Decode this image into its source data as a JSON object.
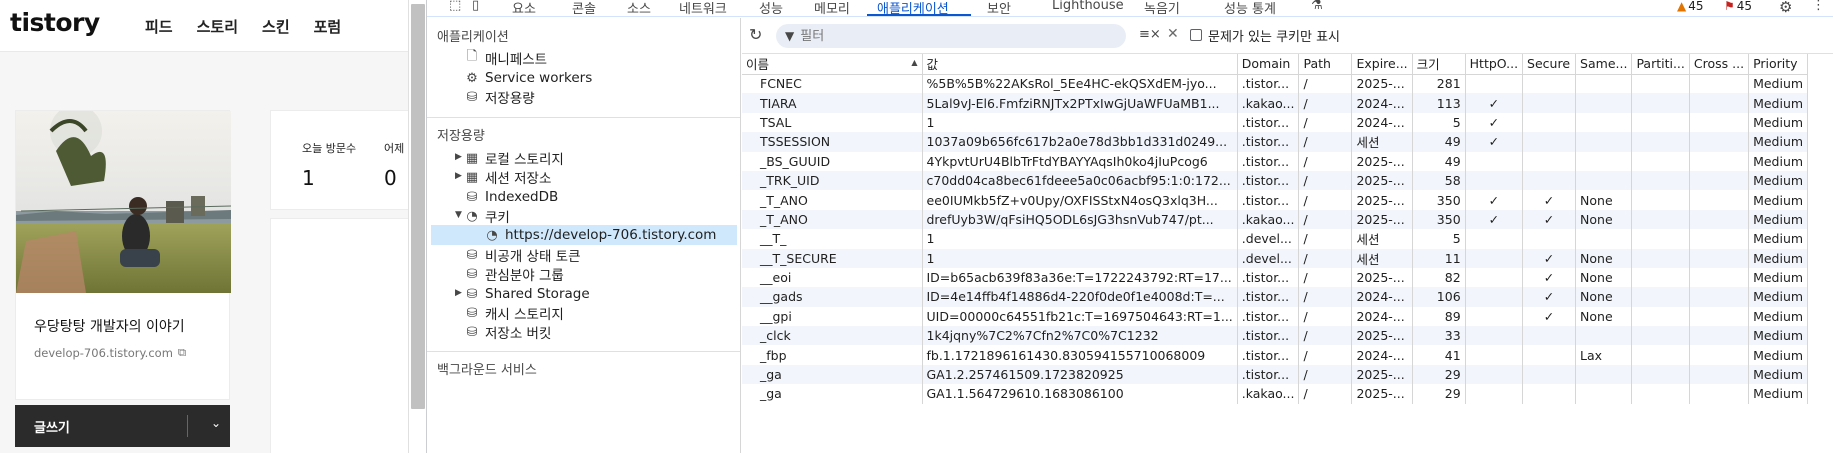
{
  "blog": {
    "logo": "tistory",
    "nav": [
      "피드",
      "스토리",
      "스킨",
      "포럼"
    ],
    "blog_name": "우당탕탕 개발자의 이야기",
    "blog_url": "develop-706.tistory.com",
    "write_button": "글쓰기",
    "stats": {
      "today_label": "오늘 방문수",
      "today_value": "1",
      "yesterday_label": "어제 방문수",
      "yesterday_value": "0"
    }
  },
  "devtools": {
    "tabs": [
      "요소",
      "콘솔",
      "소스",
      "네트워크",
      "성능",
      "메모리",
      "애플리케이션",
      "보안",
      "Lighthouse",
      "녹음기",
      "성능 통계"
    ],
    "active_tab": "애플리케이션",
    "warnings_count": "45",
    "issues_count": "45",
    "sidebar": {
      "application_header": "애플리케이션",
      "application_items": [
        "매니페스트",
        "Service workers",
        "저장용량"
      ],
      "storage_header": "저장용량",
      "storage_items": [
        "로컬 스토리지",
        "세션 저장소",
        "IndexedDB",
        "쿠키"
      ],
      "cookie_origin": "https://develop-706.tistory.com",
      "storage_items_more": [
        "비공개 상태 토큰",
        "관심분야 그룹",
        "Shared Storage",
        "캐시 스토리지",
        "저장소 버킷"
      ],
      "background_header": "백그라운드 서비스"
    },
    "toolbar": {
      "filter_placeholder": "필터",
      "only_issue_label": "문제가 있는 쿠키만 표시"
    },
    "columns": [
      "이름",
      "값",
      "Domain",
      "Path",
      "Expire...",
      "크기",
      "HttpO...",
      "Secure",
      "Same...",
      "Partiti...",
      "Cross ...",
      "Priority"
    ],
    "rows": [
      [
        "FCNEC",
        "%5B%5B%22AKsRol_5Ee4HC-ekQSXdEM-jyo...",
        ".tistor...",
        "/",
        "2025-...",
        "281",
        "",
        "",
        "",
        "",
        "",
        "Medium"
      ],
      [
        "TIARA",
        "5Lal9vJ-El6.FmfziRNJTx2PTxIwGjUaWFUaMB1...",
        ".kakao...",
        "/",
        "2024-...",
        "113",
        "✓",
        "",
        "",
        "",
        "",
        "Medium"
      ],
      [
        "TSAL",
        "1",
        ".tistor...",
        "/",
        "2024-...",
        "5",
        "✓",
        "",
        "",
        "",
        "",
        "Medium"
      ],
      [
        "TSSESSION",
        "1037a09b656fc617b2a0e78d3bb1d331d0249...",
        ".tistor...",
        "/",
        "세션",
        "49",
        "✓",
        "",
        "",
        "",
        "",
        "Medium"
      ],
      [
        "_BS_GUUID",
        "4YkpvtUrU4BlbTrFtdYBAYYAqsIh0ko4jIuPcog6",
        ".tistor...",
        "/",
        "2025-...",
        "49",
        "",
        "",
        "",
        "",
        "",
        "Medium"
      ],
      [
        "_TRK_UID",
        "c70dd04ca8bec61fdeee5a0c06acbf95:1:0:172...",
        ".tistor...",
        "/",
        "2025-...",
        "58",
        "",
        "",
        "",
        "",
        "",
        "Medium"
      ],
      [
        "_T_ANO",
        "ee0IUMkb5fZ+v0Upy/OXFISStxN4osQ3xlq3H...",
        ".tistor...",
        "/",
        "2025-...",
        "350",
        "✓",
        "✓",
        "None",
        "",
        "",
        "Medium"
      ],
      [
        "_T_ANO",
        "drefUyb3W/qFsiHQ5ODL6sJG3hsnVub747/pt...",
        ".kakao...",
        "/",
        "2025-...",
        "350",
        "✓",
        "✓",
        "None",
        "",
        "",
        "Medium"
      ],
      [
        "__T_",
        "1",
        ".devel...",
        "/",
        "세션",
        "5",
        "",
        "",
        "",
        "",
        "",
        "Medium"
      ],
      [
        "__T_SECURE",
        "1",
        ".devel...",
        "/",
        "세션",
        "11",
        "",
        "✓",
        "None",
        "",
        "",
        "Medium"
      ],
      [
        "__eoi",
        "ID=b65acb639f83a36e:T=1722243792:RT=17...",
        ".tistor...",
        "/",
        "2025-...",
        "82",
        "",
        "✓",
        "None",
        "",
        "",
        "Medium"
      ],
      [
        "__gads",
        "ID=4e14ffb4f14886d4-220f0de0f1e4008d:T=...",
        ".tistor...",
        "/",
        "2024-...",
        "106",
        "",
        "✓",
        "None",
        "",
        "",
        "Medium"
      ],
      [
        "__gpi",
        "UID=00000c64551fb21c:T=1697504643:RT=1...",
        ".tistor...",
        "/",
        "2024-...",
        "89",
        "",
        "✓",
        "None",
        "",
        "",
        "Medium"
      ],
      [
        "_clck",
        "1k4jqny%7C2%7Cfn2%7C0%7C1232",
        ".tistor...",
        "/",
        "2025-...",
        "33",
        "",
        "",
        "",
        "",
        "",
        "Medium"
      ],
      [
        "_fbp",
        "fb.1.1721896161430.830594155710068009",
        ".tistor...",
        "/",
        "2024-...",
        "41",
        "",
        "",
        "Lax",
        "",
        "",
        "Medium"
      ],
      [
        "_ga",
        "GA1.2.257461509.1723820925",
        ".tistor...",
        "/",
        "2025-...",
        "29",
        "",
        "",
        "",
        "",
        "",
        "Medium"
      ],
      [
        "_ga",
        "GA1.1.564729610.1683086100",
        ".kakao...",
        "/",
        "2025-...",
        "29",
        "",
        "",
        "",
        "",
        "",
        "Medium"
      ]
    ]
  }
}
